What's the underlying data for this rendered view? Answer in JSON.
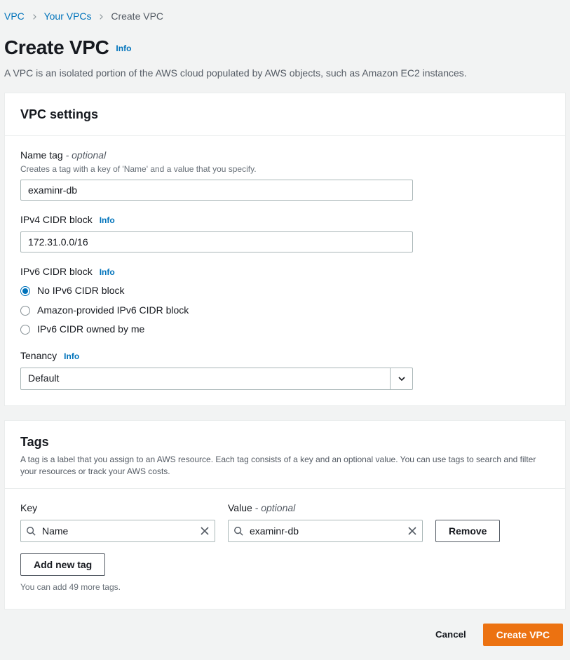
{
  "breadcrumbs": [
    {
      "label": "VPC",
      "current": false
    },
    {
      "label": "Your VPCs",
      "current": false
    },
    {
      "label": "Create VPC",
      "current": true
    }
  ],
  "page": {
    "title": "Create VPC",
    "info": "Info",
    "description": "A VPC is an isolated portion of the AWS cloud populated by AWS objects, such as Amazon EC2 instances."
  },
  "settings": {
    "heading": "VPC settings",
    "nameTag": {
      "label": "Name tag",
      "optional": "- optional",
      "help": "Creates a tag with a key of 'Name' and a value that you specify.",
      "value": "examinr-db"
    },
    "ipv4Cidr": {
      "label": "IPv4 CIDR block",
      "info": "Info",
      "value": "172.31.0.0/16"
    },
    "ipv6Cidr": {
      "label": "IPv6 CIDR block",
      "info": "Info",
      "options": [
        {
          "label": "No IPv6 CIDR block",
          "selected": true
        },
        {
          "label": "Amazon-provided IPv6 CIDR block",
          "selected": false
        },
        {
          "label": "IPv6 CIDR owned by me",
          "selected": false
        }
      ]
    },
    "tenancy": {
      "label": "Tenancy",
      "info": "Info",
      "value": "Default"
    }
  },
  "tags": {
    "heading": "Tags",
    "description": "A tag is a label that you assign to an AWS resource. Each tag consists of a key and an optional value. You can use tags to search and filter your resources or track your AWS costs.",
    "keyLabel": "Key",
    "valueLabel": "Value",
    "valueOptional": "- optional",
    "row": {
      "key": "Name",
      "value": "examinr-db"
    },
    "removeLabel": "Remove",
    "addLabel": "Add new tag",
    "hint": "You can add 49 more tags."
  },
  "footer": {
    "cancel": "Cancel",
    "submit": "Create VPC"
  }
}
